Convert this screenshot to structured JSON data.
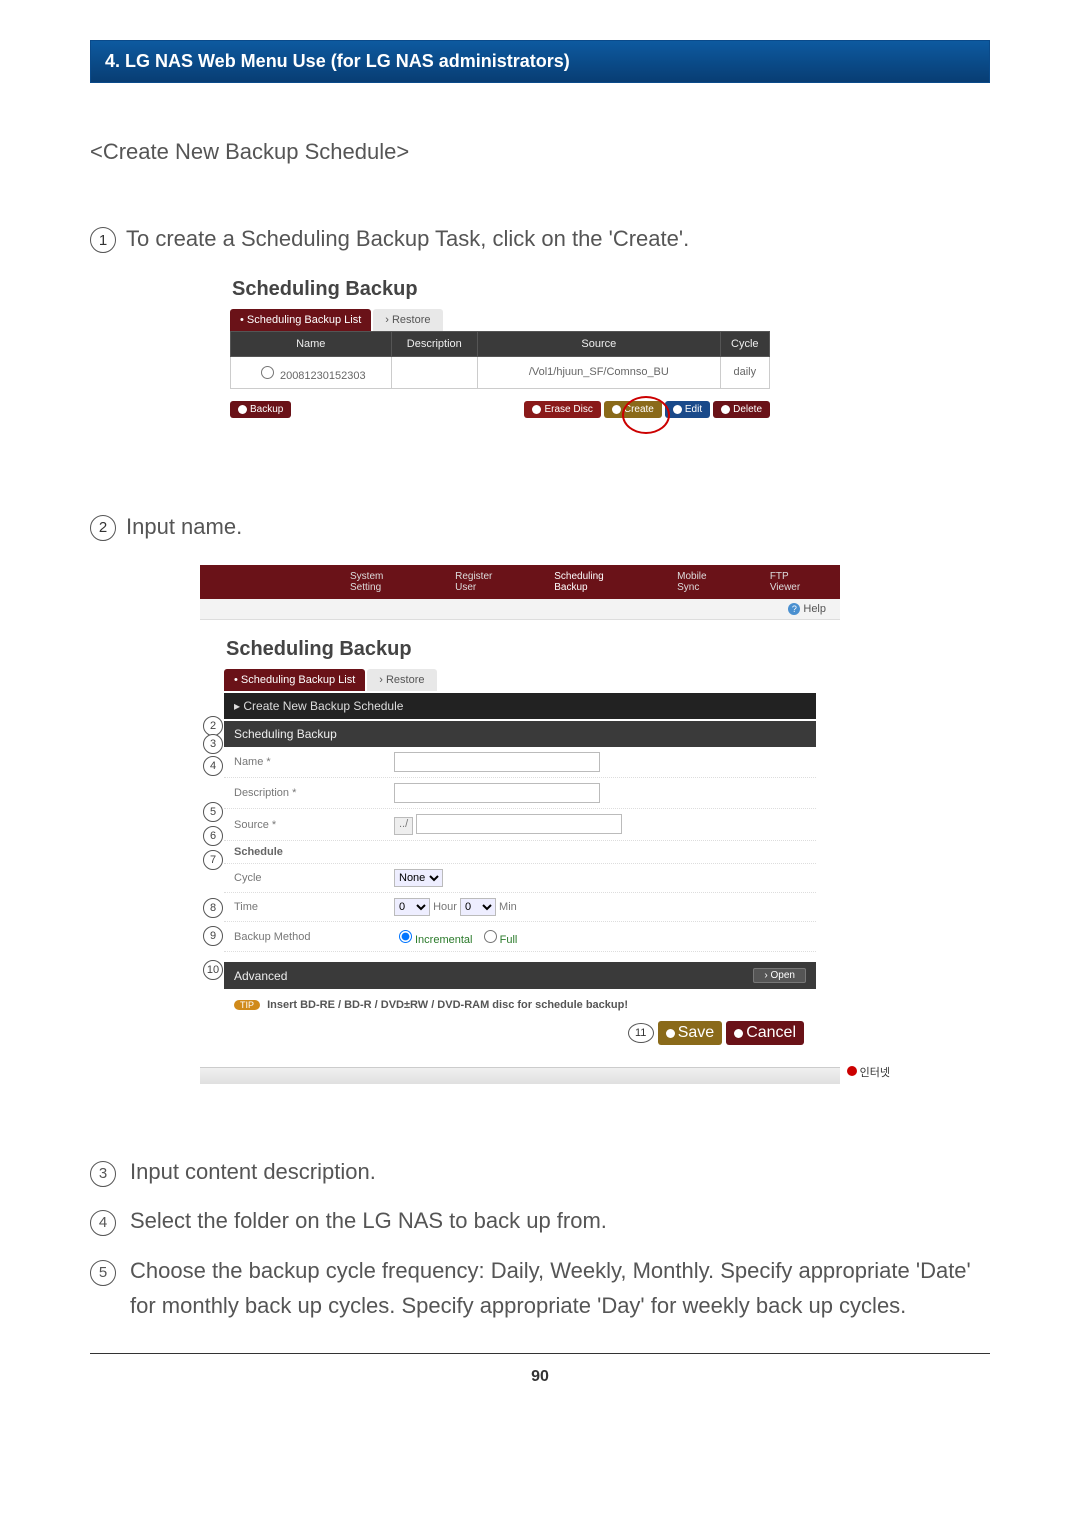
{
  "chapter_title": "4. LG NAS Web Menu Use (for LG NAS administrators)",
  "section_heading": "<Create New Backup Schedule>",
  "intro": {
    "num": "1",
    "text": "To create a Scheduling Backup Task, click on the 'Create'."
  },
  "shot1": {
    "title": "Scheduling Backup",
    "tab_active": "• Scheduling Backup List",
    "tab_inactive": "› Restore",
    "cols": {
      "name": "Name",
      "desc": "Description",
      "source": "Source",
      "cycle": "Cycle"
    },
    "row": {
      "name": "20081230152303",
      "desc": "",
      "source": "/Vol1/hjuun_SF/Comnso_BU",
      "cycle": "daily"
    },
    "btns": {
      "backup": "Backup",
      "erase": "Erase Disc",
      "create": "Create",
      "edit": "Edit",
      "delete": "Delete"
    }
  },
  "mid": {
    "num": "2",
    "text": "Input name."
  },
  "shot2": {
    "nav": {
      "a": "System Setting",
      "b": "Register User",
      "c": "Scheduling Backup",
      "d": "Mobile Sync",
      "e": "FTP Viewer"
    },
    "help": "Help",
    "title": "Scheduling Backup",
    "tab_active": "• Scheduling Backup List",
    "tab_inactive": "› Restore",
    "create_head": "Create New Backup Schedule",
    "sec_head": "Scheduling Backup",
    "labels": {
      "name": "Name *",
      "desc": "Description *",
      "source": "Source *",
      "schedule": "Schedule",
      "cycle": "Cycle",
      "time": "Time",
      "method": "Backup Method"
    },
    "fields": {
      "browse": "../",
      "cycle_val": "None",
      "hour_val": "0",
      "hour_lbl": "Hour",
      "min_val": "0",
      "min_lbl": "Min",
      "method_inc": "Incremental",
      "method_full": "Full"
    },
    "advanced": "Advanced",
    "open": "› Open",
    "tip_badge": "TIP",
    "tip_text": "Insert BD-RE / BD-R / DVD±RW / DVD-RAM disc for schedule backup!",
    "save": "Save",
    "cancel": "Cancel",
    "ext": "인터넷",
    "sidenums": {
      "n2": "2",
      "n3": "3",
      "n4": "4",
      "n5": "5",
      "n6": "6",
      "n7": "7",
      "n8": "8",
      "n9": "9",
      "n10": "10",
      "n11": "11"
    }
  },
  "steps": {
    "s3": {
      "n": "3",
      "t": "Input content description."
    },
    "s4": {
      "n": "4",
      "t": "Select the folder on the LG NAS to back up from."
    },
    "s5": {
      "n": "5",
      "t": "Choose the backup cycle frequency: Daily, Weekly, Monthly. Specify appropriate 'Date' for monthly back up cycles. Specify appropriate 'Day' for weekly back up cycles."
    }
  },
  "page_number": "90"
}
